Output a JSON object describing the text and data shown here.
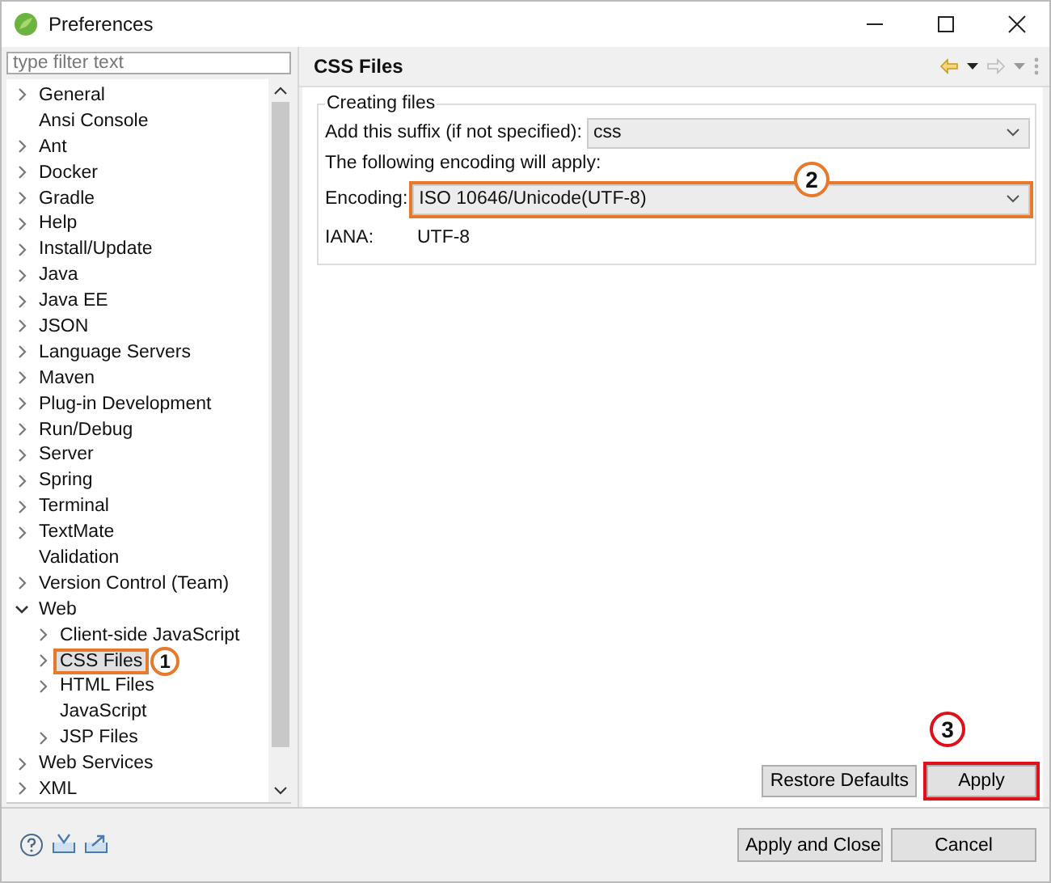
{
  "window": {
    "title": "Preferences"
  },
  "filter": {
    "placeholder": "type filter text"
  },
  "tree": [
    {
      "label": "General",
      "expanded": false,
      "selected": false
    },
    {
      "label": "Ansi Console",
      "selected": false
    },
    {
      "label": "Ant",
      "expanded": false,
      "selected": false
    },
    {
      "label": "Docker",
      "expanded": false,
      "selected": false
    },
    {
      "label": "Gradle",
      "expanded": false,
      "selected": false
    },
    {
      "label": "Help",
      "expanded": false,
      "selected": false
    },
    {
      "label": "Install/Update",
      "expanded": false,
      "selected": false
    },
    {
      "label": "Java",
      "expanded": false,
      "selected": false
    },
    {
      "label": "Java EE",
      "expanded": false,
      "selected": false
    },
    {
      "label": "JSON",
      "expanded": false,
      "selected": false
    },
    {
      "label": "Language Servers",
      "expanded": false,
      "selected": false
    },
    {
      "label": "Maven",
      "expanded": false,
      "selected": false
    },
    {
      "label": "Plug-in Development",
      "expanded": false,
      "selected": false
    },
    {
      "label": "Run/Debug",
      "expanded": false,
      "selected": false
    },
    {
      "label": "Server",
      "expanded": false,
      "selected": false
    },
    {
      "label": "Spring",
      "expanded": false,
      "selected": false
    },
    {
      "label": "Terminal",
      "expanded": false,
      "selected": false
    },
    {
      "label": "TextMate",
      "expanded": false,
      "selected": false
    },
    {
      "label": "Validation",
      "selected": false
    },
    {
      "label": "Version Control (Team)",
      "expanded": false,
      "selected": false
    },
    {
      "label": "Web",
      "expanded": true,
      "selected": false,
      "children": [
        {
          "label": "Client-side JavaScript",
          "expanded": false,
          "selected": false
        },
        {
          "label": "CSS Files",
          "expanded": false,
          "selected": true,
          "callout": {
            "number": "1",
            "color": "#e8792b"
          }
        },
        {
          "label": "HTML Files",
          "expanded": false,
          "selected": false
        },
        {
          "label": "JavaScript",
          "selected": false
        },
        {
          "label": "JSP Files",
          "expanded": false,
          "selected": false
        }
      ]
    },
    {
      "label": "Web Services",
      "expanded": false,
      "selected": false
    },
    {
      "label": "XML",
      "expanded": false,
      "selected": false
    }
  ],
  "page": {
    "title": "CSS Files",
    "group": {
      "title": "Creating files",
      "suffix": {
        "label": "Add this suffix (if not specified):",
        "value": "css"
      },
      "note": "The following encoding will apply:",
      "encoding": {
        "label": "Encoding:",
        "value": "ISO 10646/Unicode(UTF-8)",
        "callout": {
          "number": "2",
          "color": "#e8792b"
        }
      },
      "iana": {
        "label": "IANA:",
        "value": "UTF-8"
      }
    },
    "buttons": [
      {
        "label": "Restore Defaults"
      },
      {
        "label": "Apply",
        "callout": {
          "number": "3",
          "color": "#e0101a"
        }
      }
    ]
  },
  "footer_buttons": [
    {
      "label": "Apply and Close"
    },
    {
      "label": "Cancel"
    }
  ]
}
